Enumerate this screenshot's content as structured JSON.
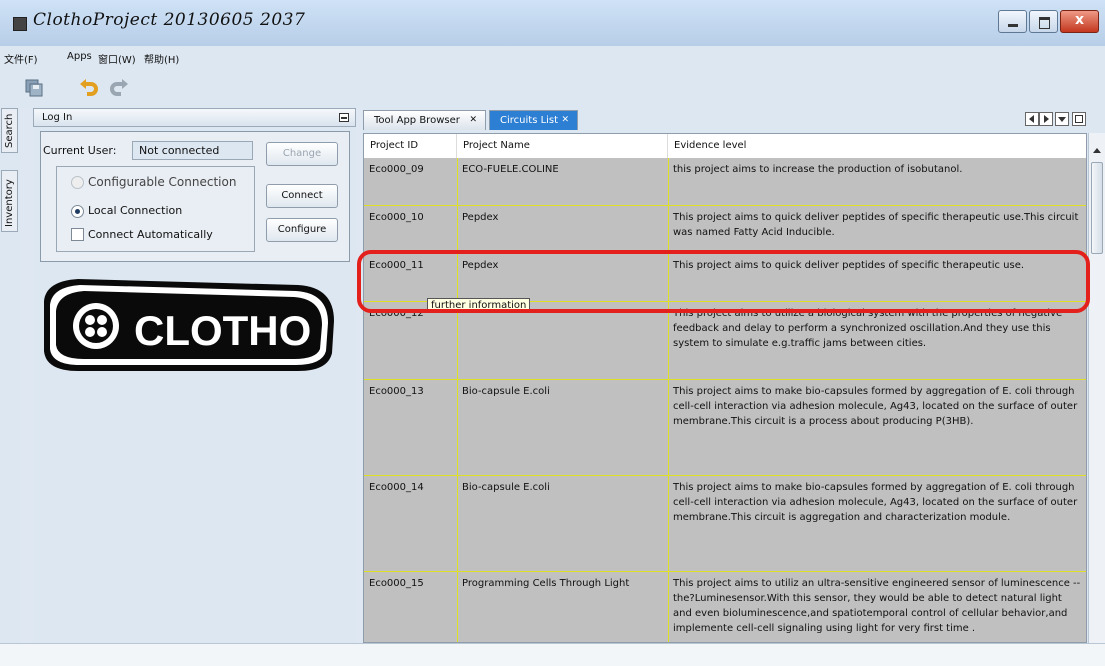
{
  "window": {
    "title": "ClothoProject 20130605 2037",
    "buttons": {
      "minimize": "minimize",
      "maximize": "maximize",
      "close": "x"
    }
  },
  "menubar": {
    "items": [
      "文件(F)",
      "Apps",
      "窗口(W)",
      "帮助(H)"
    ]
  },
  "toolbar": {
    "icons": [
      "save-all-icon",
      "undo-icon",
      "redo-icon"
    ]
  },
  "side_tabs": [
    "Search",
    "Inventory"
  ],
  "login_panel": {
    "title": "Log In",
    "current_user_label": "Current User:",
    "current_user_value": "Not connected",
    "options": {
      "configurable": "Configurable Connection",
      "local": "Local Connection",
      "auto": "Connect Automatically"
    },
    "buttons": {
      "change": "Change",
      "connect": "Connect",
      "configure": "Configure"
    }
  },
  "logo_text": "CLOTHO",
  "tabs": [
    {
      "label": "Tool App Browser",
      "active": false
    },
    {
      "label": "Circuits List",
      "active": true
    }
  ],
  "table": {
    "headers": [
      "Project ID",
      "Project Name",
      "Evidence level"
    ],
    "rows": [
      {
        "id": "Eco000_09",
        "name": "ECO-FUELE.COLINE",
        "evidence": "this project aims to increase the production of isobutanol."
      },
      {
        "id": "Eco000_10",
        "name": "Pepdex",
        "evidence": "This project aims to quick deliver peptides of specific therapeutic use.This circuit was named Fatty Acid Inducible."
      },
      {
        "id": "Eco000_11",
        "name": "Pepdex",
        "evidence": "This project aims to quick deliver peptides of specific therapeutic use."
      },
      {
        "id": "Eco000_12",
        "name": "",
        "evidence": "This project aims to utilize a biological system with the properties of negative feedback and delay to perform a synchronized oscillation.And they use this system to simulate e.g.traffic jams between cities."
      },
      {
        "id": "Eco000_13",
        "name": "Bio-capsule E.coli",
        "evidence": "This project aims to make bio-capsules formed by aggregation of E. coli through cell-cell interaction via adhesion molecule, Ag43, located on the surface of outer membrane.This circuit is a process about producing P(3HB)."
      },
      {
        "id": "Eco000_14",
        "name": "Bio-capsule E.coli",
        "evidence": "This project aims to make bio-capsules formed by aggregation of E. coli through cell-cell interaction via adhesion molecule, Ag43, located on the surface of outer membrane.This circuit is aggregation and characterization module."
      },
      {
        "id": "Eco000_15",
        "name": "Programming Cells Through Light",
        "evidence": "This project aims to utiliz an ultra-sensitive engineered sensor of luminescence -- the?Luminesensor.With this sensor, they would be able to detect natural light and even bioluminescence,and spatiotemporal control of cellular behavior,and implemente cell-cell signaling using light for very first time ."
      }
    ]
  },
  "tooltip": "further information",
  "colors": {
    "active_tab": "#2d7fd3",
    "highlight": "#e3201b",
    "grid_line": "#e0e022",
    "row_bg": "#c0c0c0"
  }
}
